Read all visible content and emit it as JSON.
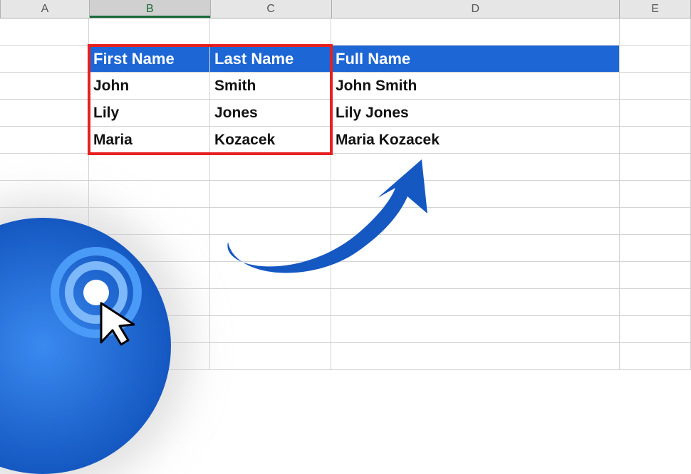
{
  "columns": [
    "A",
    "B",
    "C",
    "D",
    "E"
  ],
  "selected_column": "B",
  "table": {
    "headers": {
      "first_name": "First Name",
      "last_name": "Last Name",
      "full_name": "Full Name"
    },
    "rows": [
      {
        "first": "John",
        "last": "Smith",
        "full": "John Smith"
      },
      {
        "first": "Lily",
        "last": "Jones",
        "full": "Lily  Jones"
      },
      {
        "first": "Maria",
        "last": "Kozacek",
        "full": "Maria Kozacek"
      }
    ]
  },
  "icons": {
    "cursor": "cursor-icon",
    "target": "target-rings-icon",
    "arrow": "curved-arrow-icon"
  },
  "colors": {
    "header_blue": "#1c66d6",
    "highlight_red": "#e62020",
    "arrow_blue": "#1558c2"
  }
}
